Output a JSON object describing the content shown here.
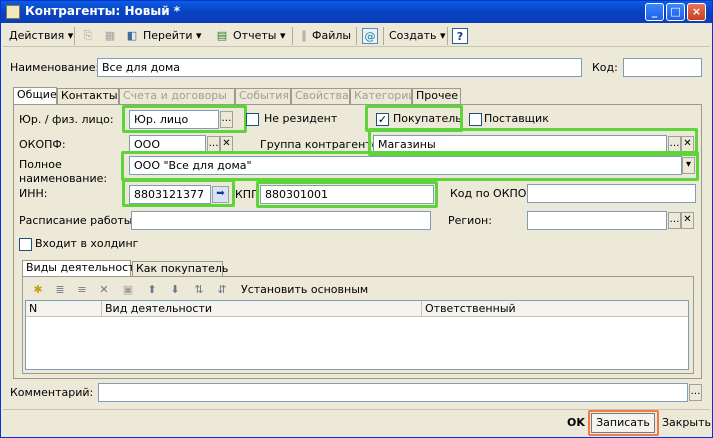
{
  "window": {
    "title": "Контрагенты: Новый *",
    "controls": [
      "_",
      "□",
      "×"
    ]
  },
  "toolbar": {
    "actions_label": "Действия",
    "goto_label": "Перейти",
    "reports_label": "Отчеты",
    "files_label": "Файлы",
    "create_label": "Создать",
    "help_label": "?"
  },
  "header": {
    "name_label": "Наименование:",
    "name_value": "Все для дома",
    "code_label": "Код:",
    "code_value": ""
  },
  "tabs": [
    {
      "label": "Общие",
      "state": "active"
    },
    {
      "label": "Контакты",
      "state": "normal"
    },
    {
      "label": "Счета и договоры",
      "state": "disabled"
    },
    {
      "label": "События",
      "state": "disabled"
    },
    {
      "label": "Свойства",
      "state": "disabled"
    },
    {
      "label": "Категории",
      "state": "disabled"
    },
    {
      "label": "Прочее",
      "state": "normal"
    }
  ],
  "general": {
    "entity_type_label": "Юр. / физ. лицо:",
    "entity_type_value": "Юр. лицо",
    "nonresident_label": "Не резидент",
    "nonresident_checked": false,
    "buyer_label": "Покупатель",
    "buyer_checked": true,
    "supplier_label": "Поставщик",
    "supplier_checked": false,
    "okopf_label": "ОКОПФ:",
    "okopf_value": "ООО",
    "group_label": "Группа контрагентов:",
    "group_value": "Магазины",
    "full_name_label": "Полное наименование:",
    "full_name_value": "ООО \"Все для дома\"",
    "inn_label": "ИНН:",
    "inn_value": "8803121377",
    "kpp_label": "КПП:",
    "kpp_value": "880301001",
    "okpo_label": "Код по ОКПО:",
    "okpo_value": "",
    "schedule_label": "Расписание работы:",
    "schedule_value": "",
    "region_label": "Регион:",
    "region_value": "",
    "holding_label": "Входит в холдинг",
    "holding_checked": false
  },
  "subtabs": [
    {
      "label": "Виды деятельности",
      "state": "active"
    },
    {
      "label": "Как покупатель",
      "state": "normal"
    }
  ],
  "activity_toolbar": {
    "set_main_label": "Установить основным"
  },
  "activity_table": {
    "columns": [
      "N",
      "Вид деятельности",
      "Ответственный"
    ],
    "rows": []
  },
  "comment": {
    "label": "Комментарий:",
    "value": ""
  },
  "footer": {
    "ok_label": "OK",
    "save_label": "Записать",
    "close_label": "Закрыть"
  },
  "colors": {
    "highlight_green": "#5fd33a",
    "highlight_orange": "#f07a4a",
    "title_blue": "#0842c2"
  }
}
